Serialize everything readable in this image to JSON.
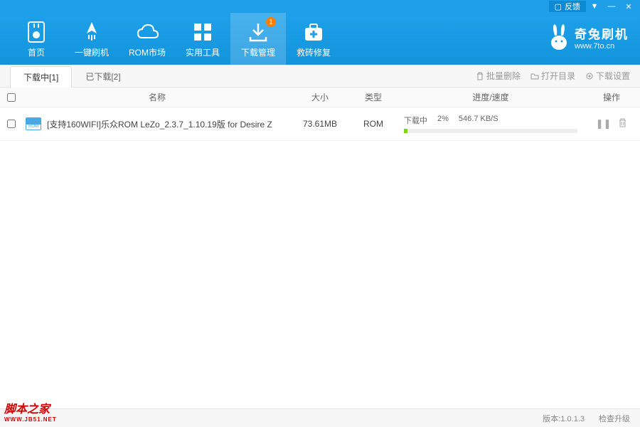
{
  "titlebar": {
    "feedback": "反馈"
  },
  "nav": [
    {
      "label": "首页"
    },
    {
      "label": "一键刷机"
    },
    {
      "label": "ROM市场"
    },
    {
      "label": "实用工具"
    },
    {
      "label": "下载管理",
      "badge": "1"
    },
    {
      "label": "救砖修复"
    }
  ],
  "brand": {
    "name": "奇兔刷机",
    "url": "www.7to.cn"
  },
  "tabs": [
    {
      "label": "下载中[1]",
      "active": true
    },
    {
      "label": "已下载[2]",
      "active": false
    }
  ],
  "toolActions": {
    "batchDelete": "批量删除",
    "openDir": "打开目录",
    "settings": "下载设置"
  },
  "columns": {
    "name": "名称",
    "size": "大小",
    "type": "类型",
    "progress": "进度/速度",
    "action": "操作"
  },
  "rows": [
    {
      "name": "[支持160WIFI]乐众ROM LeZo_2.3.7_1.10.19版 for Desire Z",
      "size": "73.61MB",
      "type": "ROM",
      "status": "下载中",
      "percentText": "2%",
      "percentWidth": "2%",
      "speed": "546.7 KB/S"
    }
  ],
  "footer": {
    "version": "版本:1.0.1.3",
    "check": "检查升级"
  },
  "watermark": {
    "main": "脚本之家",
    "sub": "WWW.JB51.NET"
  }
}
